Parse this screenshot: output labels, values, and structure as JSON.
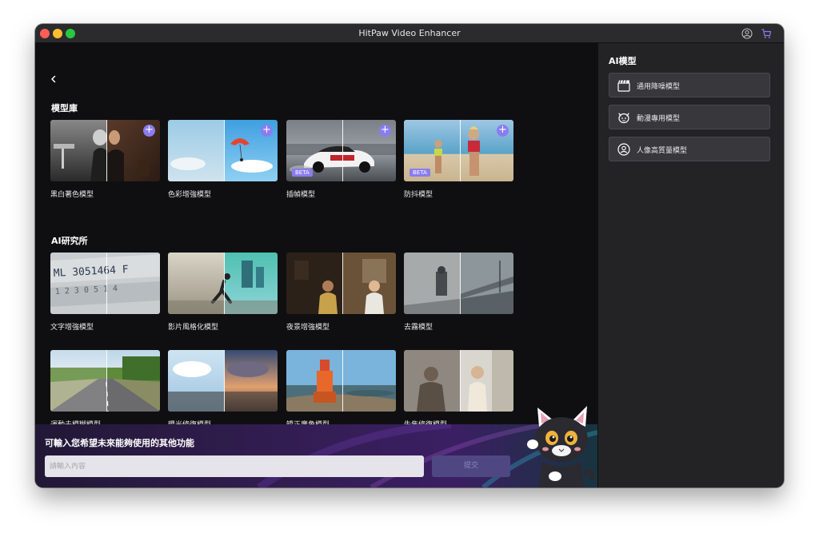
{
  "window": {
    "title": "HitPaw Video Enhancer"
  },
  "titlebar_icons": [
    "account-icon",
    "cart-icon"
  ],
  "model_library": {
    "title": "模型庫",
    "items": [
      {
        "label": "黑白著色模型",
        "beta": false
      },
      {
        "label": "色彩增強模型",
        "beta": false
      },
      {
        "label": "插幀模型",
        "beta": true,
        "badge": "BETA"
      },
      {
        "label": "防抖模型",
        "beta": true,
        "badge": "BETA"
      }
    ]
  },
  "ai_lab": {
    "title": "AI研究所",
    "items": [
      {
        "label": "文字增強模型"
      },
      {
        "label": "影片風格化模型"
      },
      {
        "label": "夜景增強模型"
      },
      {
        "label": "去霧模型"
      },
      {
        "label": "運動去模糊模型"
      },
      {
        "label": "曝光修復模型"
      },
      {
        "label": "矯正廣角模型"
      },
      {
        "label": "失焦修復模型"
      }
    ]
  },
  "feedback": {
    "title": "可輸入您希望未來能夠使用的其他功能",
    "placeholder": "請輸入內容",
    "submit_label": "提交"
  },
  "sidebar": {
    "title": "AI模型",
    "items": [
      {
        "label": "通用降噪模型",
        "icon": "clapperboard-icon"
      },
      {
        "label": "動漫專用模型",
        "icon": "anime-face-icon"
      },
      {
        "label": "人像高質量模型",
        "icon": "portrait-icon"
      }
    ]
  },
  "colors": {
    "accent": "#8a7cf0",
    "panel": "#232326",
    "background": "#0f0f11"
  }
}
